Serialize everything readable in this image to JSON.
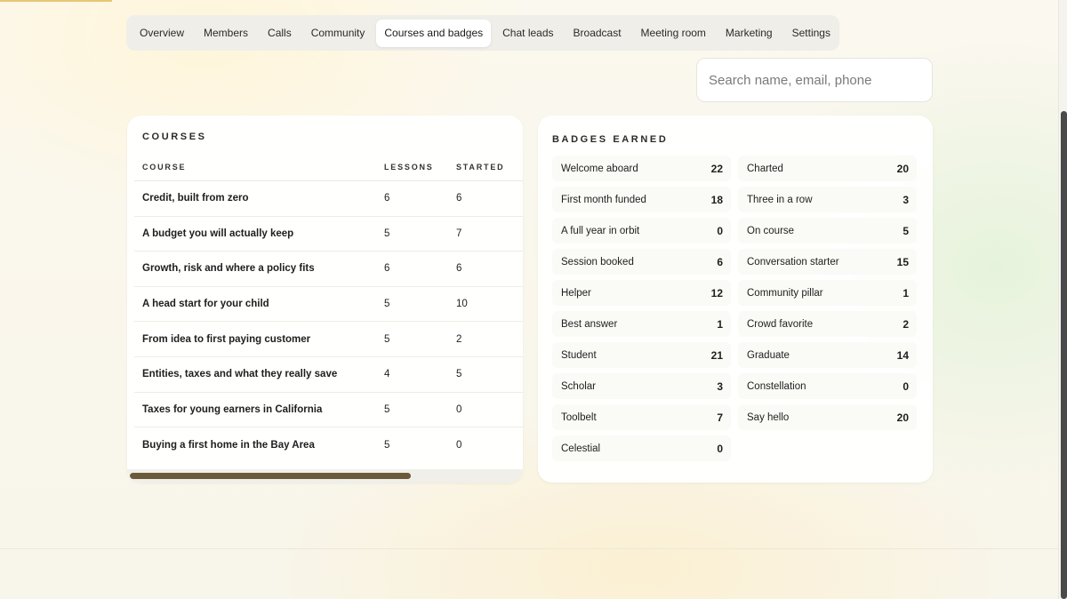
{
  "tabs": [
    {
      "label": "Overview",
      "active": false
    },
    {
      "label": "Members",
      "active": false
    },
    {
      "label": "Calls",
      "active": false
    },
    {
      "label": "Community",
      "active": false
    },
    {
      "label": "Courses and badges",
      "active": true
    },
    {
      "label": "Chat leads",
      "active": false
    },
    {
      "label": "Broadcast",
      "active": false
    },
    {
      "label": "Meeting room",
      "active": false
    },
    {
      "label": "Marketing",
      "active": false
    },
    {
      "label": "Settings",
      "active": false
    }
  ],
  "search": {
    "placeholder": "Search name, email, phone",
    "value": ""
  },
  "courses": {
    "title": "COURSES",
    "columns": [
      "COURSE",
      "LESSONS",
      "STARTED"
    ],
    "rows": [
      {
        "course": "Credit, built from zero",
        "lessons": "6",
        "started": "6"
      },
      {
        "course": "A budget you will actually keep",
        "lessons": "5",
        "started": "7"
      },
      {
        "course": "Growth, risk and where a policy fits",
        "lessons": "6",
        "started": "6"
      },
      {
        "course": "A head start for your child",
        "lessons": "5",
        "started": "10"
      },
      {
        "course": "From idea to first paying customer",
        "lessons": "5",
        "started": "2"
      },
      {
        "course": "Entities, taxes and what they really save",
        "lessons": "4",
        "started": "5"
      },
      {
        "course": "Taxes for young earners in California",
        "lessons": "5",
        "started": "0"
      },
      {
        "course": "Buying a first home in the Bay Area",
        "lessons": "5",
        "started": "0"
      }
    ]
  },
  "badges": {
    "title": "BADGES EARNED",
    "items": [
      {
        "name": "Welcome aboard",
        "count": "22"
      },
      {
        "name": "Charted",
        "count": "20"
      },
      {
        "name": "First month funded",
        "count": "18"
      },
      {
        "name": "Three in a row",
        "count": "3"
      },
      {
        "name": "A full year in orbit",
        "count": "0"
      },
      {
        "name": "On course",
        "count": "5"
      },
      {
        "name": "Session booked",
        "count": "6"
      },
      {
        "name": "Conversation starter",
        "count": "15"
      },
      {
        "name": "Helper",
        "count": "12"
      },
      {
        "name": "Community pillar",
        "count": "1"
      },
      {
        "name": "Best answer",
        "count": "1"
      },
      {
        "name": "Crowd favorite",
        "count": "2"
      },
      {
        "name": "Student",
        "count": "21"
      },
      {
        "name": "Graduate",
        "count": "14"
      },
      {
        "name": "Scholar",
        "count": "3"
      },
      {
        "name": "Constellation",
        "count": "0"
      },
      {
        "name": "Toolbelt",
        "count": "7"
      },
      {
        "name": "Say hello",
        "count": "20"
      },
      {
        "name": "Celestial",
        "count": "0"
      }
    ]
  }
}
